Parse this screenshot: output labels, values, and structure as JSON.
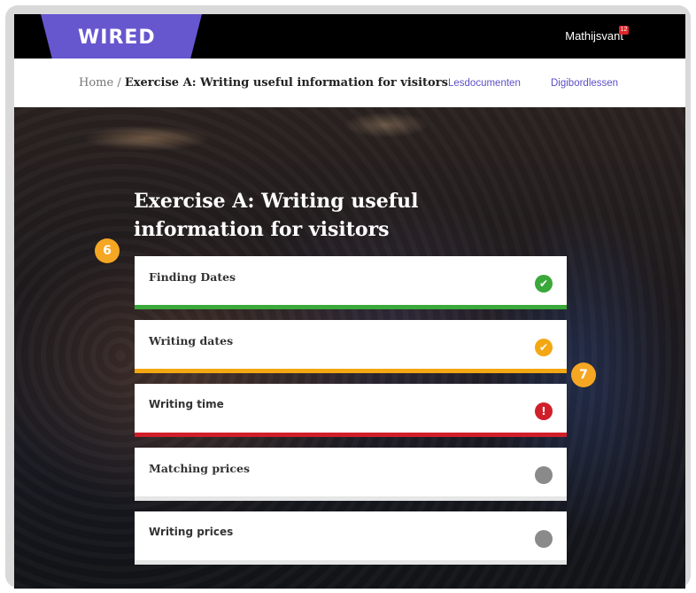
{
  "header": {
    "logo": "WIRED",
    "user_name": "Mathijsvant",
    "notification_count": "12"
  },
  "breadcrumb": {
    "home": "Home",
    "separator": "/",
    "current": "Exercise A: Writing useful information for visitors"
  },
  "nav_links": [
    "Lesdocumenten",
    "Digibordlessen"
  ],
  "main": {
    "title": "Exercise A: Writing useful information for visitors",
    "items": [
      {
        "label": "Finding Dates",
        "status": "completed",
        "icon": "check-icon",
        "color": "#3aa83a"
      },
      {
        "label": "Writing dates",
        "status": "partial",
        "icon": "check-icon",
        "color": "#f3a712"
      },
      {
        "label": "Writing time",
        "status": "error",
        "icon": "exclamation-icon",
        "color": "#d01f2a"
      },
      {
        "label": "Matching prices",
        "status": "not-started",
        "icon": "dot-icon",
        "color": "#8a8a8a"
      },
      {
        "label": "Writing prices",
        "status": "not-started",
        "icon": "dot-icon",
        "color": "#8a8a8a"
      }
    ]
  },
  "markers": [
    "6",
    "7"
  ],
  "colors": {
    "brand": "#6657cf",
    "marker": "#f5a623"
  }
}
